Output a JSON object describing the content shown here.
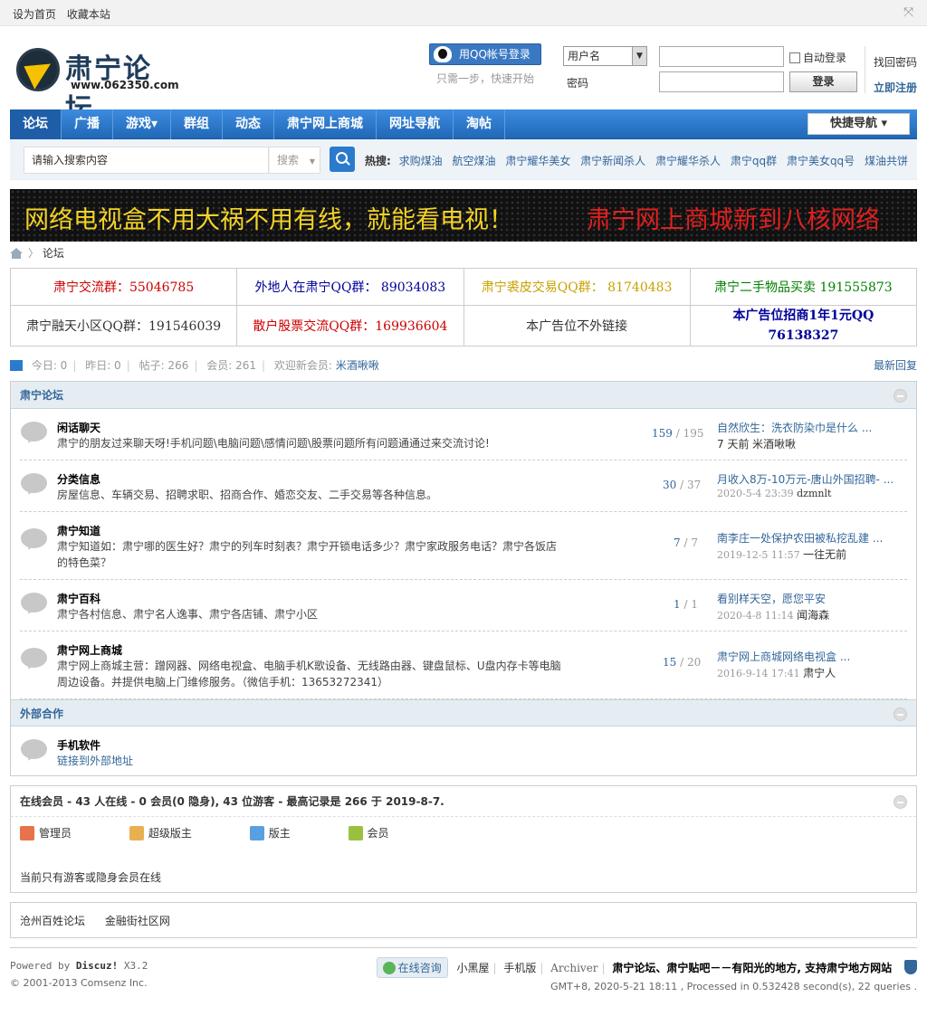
{
  "topbar": {
    "set_home": "设为首页",
    "bookmark": "收藏本站"
  },
  "logo": {
    "name": "肃宁论坛",
    "url": "www.062350.com"
  },
  "qq_login": {
    "button": "用QQ帐号登录",
    "sub": "只需一步，快速开始"
  },
  "login": {
    "username_select": "用户名",
    "password_label": "密码",
    "auto_login": "自动登录",
    "login_button": "登录",
    "forgot": "找回密码",
    "register": "立即注册"
  },
  "nav": {
    "items": [
      "论坛",
      "广播",
      "游戏▾",
      "群组",
      "动态",
      "肃宁网上商城",
      "网址导航",
      "淘帖"
    ],
    "quick_nav": "快捷导航 ▾"
  },
  "search": {
    "placeholder": "请输入搜索内容",
    "type": "搜索",
    "hot_label": "热搜:",
    "hot": [
      "求购煤油",
      "航空煤油",
      "肃宁耀华美女",
      "肃宁新闻杀人",
      "肃宁耀华杀人",
      "肃宁qq群",
      "肃宁美女qq号",
      "煤油共饼"
    ]
  },
  "banner": {
    "left": "网络电视盒不用大祸不用有线，就能看电视！",
    "right": "肃宁网上商城新到八核网络"
  },
  "breadcrumb": {
    "current": "论坛"
  },
  "qq_groups": [
    [
      {
        "text": "肃宁交流群：55046785",
        "color": "#cc0000"
      },
      {
        "text": "外地人在肃宁QQ群： 89034083",
        "color": "#000099"
      },
      {
        "text": "肃宁裘皮交易QQ群： 81740483",
        "color": "#c8a000"
      },
      {
        "text": "肃宁二手物品买卖  191555873",
        "color": "#008000"
      }
    ],
    [
      {
        "text": "肃宁融天小区QQ群：191546039",
        "color": "#333333"
      },
      {
        "text": "散户股票交流QQ群：169936604",
        "color": "#cc0000"
      },
      {
        "text": "本广告位不外链接",
        "color": "#333333"
      },
      {
        "text": "本广告位招商1年1元QQ 76138327",
        "color": "#000099"
      }
    ]
  ],
  "stats": {
    "today": "今日: 0",
    "yesterday": "昨日: 0",
    "posts": "帖子: 266",
    "members": "会员: 261",
    "welcome": "欢迎新会员:",
    "new_member": "米酒啾啾",
    "latest": "最新回复"
  },
  "forum_group": {
    "title": "肃宁论坛",
    "forums": [
      {
        "name": "闲话聊天",
        "desc": "肃宁的朋友过来聊天呀!手机问题\\电脑问题\\感情问题\\股票问题所有问题通通过来交流讨论!",
        "threads": "159",
        "posts": "195",
        "last": "自然欣生：洗衣防染巾是什么 ...",
        "time": "7 天前",
        "author": "米酒啾啾"
      },
      {
        "name": "分类信息",
        "desc": "房屋信息、车辆交易、招聘求职、招商合作、婚恋交友、二手交易等各种信息。",
        "threads": "30",
        "posts": "37",
        "last": "月收入8万-10万元-唐山外国招聘- ...",
        "time": "2020-5-4 23:39",
        "author": "dzmnlt"
      },
      {
        "name": "肃宁知道",
        "desc": "肃宁知道如：肃宁哪的医生好？肃宁的列车时刻表？肃宁开锁电话多少？肃宁家政服务电话？肃宁各饭店的特色菜？",
        "threads": "7",
        "posts": "7",
        "last": "南李庄一处保护农田被私挖乱建 ...",
        "time": "2019-12-5 11:57",
        "author": "一往无前"
      },
      {
        "name": "肃宁百科",
        "desc": "肃宁各村信息、肃宁名人逸事、肃宁各店铺、肃宁小区",
        "threads": "1",
        "posts": "1",
        "last": "看别样天空，愿您平安",
        "time": "2020-4-8 11:14",
        "author": "闻海森"
      },
      {
        "name": "肃宁网上商城",
        "desc": "肃宁网上商城主营：蹭网器、网络电视盒、电脑手机K歌设备、无线路由器、键盘鼠标、U盘内存卡等电脑周边设备。并提供电脑上门维修服务。（微信手机：13653272341）",
        "threads": "15",
        "posts": "20",
        "last": "肃宁网上商城网络电视盒 ...",
        "time": "2016-9-14 17:41",
        "author": "肃宁人"
      }
    ]
  },
  "external_group": {
    "title": "外部合作",
    "forums": [
      {
        "name": "手机软件",
        "desc": "链接到外部地址"
      }
    ]
  },
  "online": {
    "header": "在线会员 - 43 人在线 - 0 会员(0 隐身), 43 位游客 - 最高记录是 266 于 2019-8-7.",
    "legend": [
      {
        "label": "管理员",
        "color": "#e8734a"
      },
      {
        "label": "超级版主",
        "color": "#e8b050"
      },
      {
        "label": "版主",
        "color": "#5aa0e0"
      },
      {
        "label": "会员",
        "color": "#9ac040"
      }
    ],
    "message": "当前只有游客或隐身会员在线"
  },
  "friend_links": [
    "沧州百姓论坛",
    "金融街社区网"
  ],
  "footer": {
    "powered": "Powered by",
    "product": "Discuz!",
    "version": "X3.2",
    "copyright": "© 2001-2013 Comsenz Inc.",
    "online_consult": "在线咨询",
    "links": [
      "小黑屋",
      "手机版",
      "Archiver"
    ],
    "slogan": "肃宁论坛、肃宁贴吧－－有阳光的地方, 支持肃宁地方网站",
    "gmt": "GMT+8, 2020-5-21 18:11 , Processed in 0.532428 second(s), 22 queries ."
  }
}
